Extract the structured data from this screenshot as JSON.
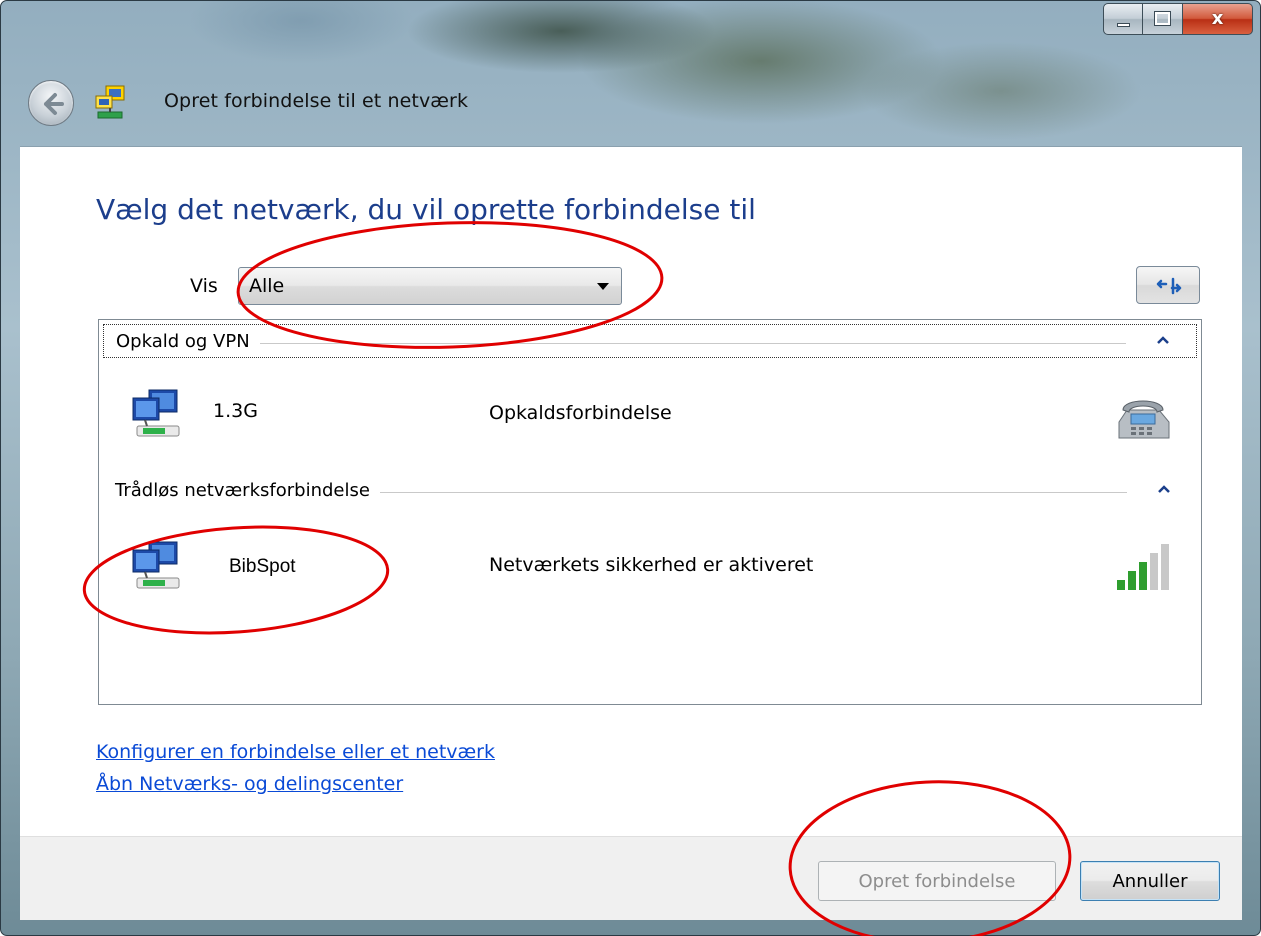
{
  "window": {
    "title": "Opret forbindelse til et netværk",
    "caption_close": "x"
  },
  "main": {
    "heading": "Vælg det netværk, du vil oprette forbindelse til",
    "show_label": "Vis",
    "show_select_value": "Alle"
  },
  "groups": [
    {
      "label": "Opkald og VPN",
      "items": [
        {
          "name": "1.3G",
          "description": "Opkaldsforbindelse",
          "right_icon": "telephone-icon"
        }
      ]
    },
    {
      "label": "Trådløs netværksforbindelse",
      "items": [
        {
          "name": "BibSpot",
          "description": "Netværkets sikkerhed er aktiveret",
          "right_icon": "signal-strength-icon",
          "signal_bars": 3,
          "signal_max": 5
        }
      ]
    }
  ],
  "links": {
    "setup": "Konfigurer en forbindelse eller et netværk",
    "center": "Åbn Netværks- og delingscenter"
  },
  "footer": {
    "connect_label": "Opret forbindelse",
    "cancel_label": "Annuller"
  },
  "colors": {
    "heading": "#1c3e8c",
    "link": "#0a4ad6",
    "annotation": "#e00000",
    "signal_on": "#2f9e2f",
    "signal_off": "#c8c8c8"
  }
}
